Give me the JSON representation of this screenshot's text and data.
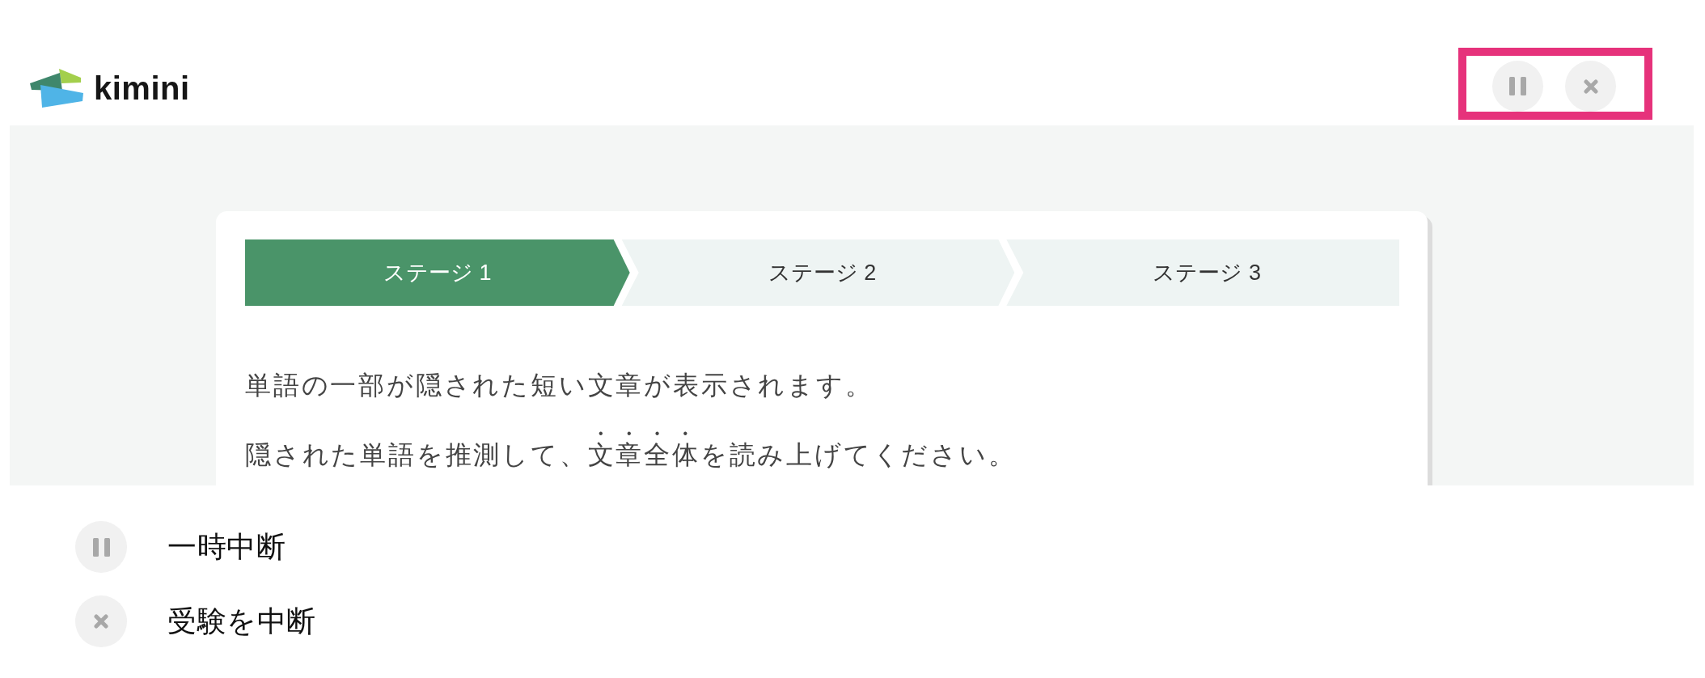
{
  "header": {
    "logo": {
      "text": "kimini"
    },
    "controls": [
      {
        "kind": "pause"
      },
      {
        "kind": "close"
      }
    ],
    "controls_highlighted": true
  },
  "stages": [
    {
      "label": "ステージ 1",
      "current": true
    },
    {
      "label": "ステージ 2",
      "current": false
    },
    {
      "label": "ステージ 3",
      "current": false
    }
  ],
  "instructions": [
    {
      "parts": [
        {
          "text": "単語の一部が隠された短い文章が表示されます。",
          "emphasis": false
        }
      ]
    },
    {
      "parts": [
        {
          "text": "隠された単語を推測して、",
          "emphasis": false
        },
        {
          "text": "文章全体",
          "emphasis": true
        },
        {
          "text": "を読み上げてください。",
          "emphasis": false
        }
      ]
    }
  ],
  "legend": [
    {
      "kind": "pause",
      "label": "一時中断"
    },
    {
      "kind": "close",
      "label": "受験を中断"
    }
  ]
}
